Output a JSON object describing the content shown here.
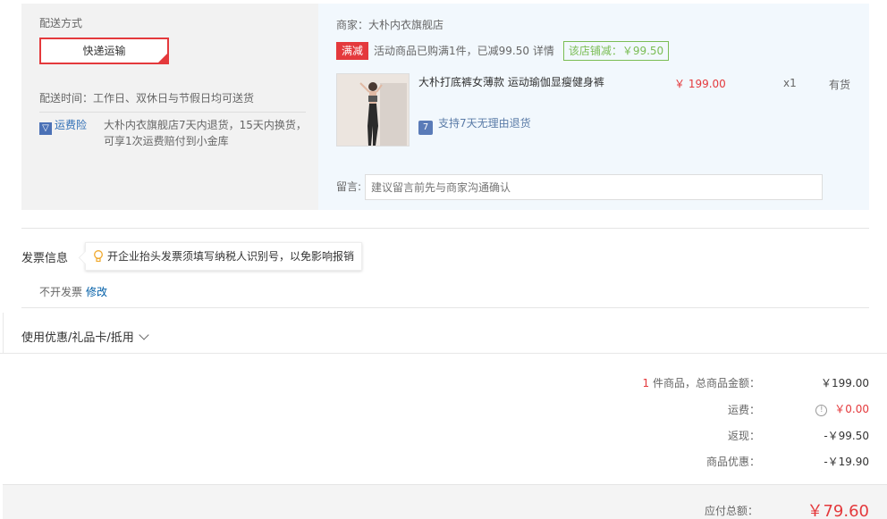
{
  "shipping": {
    "label": "配送方式",
    "method": "快递运输",
    "time_label": "配送时间：",
    "time_value": "工作日、双休日与节假日均可送货",
    "insurance_label": "运费险",
    "insurance_icon": "v-shield-icon",
    "insurance_text": "大朴内衣旗舰店7天内退货，15天内换货，可享1次运费赔付到小金库"
  },
  "shop": {
    "name": "商家：大朴内衣旗舰店",
    "promo_tag": "满减",
    "promo_text": "活动商品已购满1件，已减99.50 详情",
    "store_discount": "该店铺减：￥99.50"
  },
  "item": {
    "title": "大朴打底裤女薄款 运动瑜伽显瘦健身裤",
    "price": "￥ 199.00",
    "qty": "x1",
    "stock": "有货",
    "return_text": "支持7天无理由退货",
    "return_icon": "7-day-return-icon"
  },
  "message": {
    "label": "留言:",
    "placeholder": "建议留言前先与商家沟通确认"
  },
  "invoice": {
    "title": "发票信息",
    "tip": "开企业抬头发票须填写纳税人识别号，以免影响报销",
    "value": "不开发票",
    "edit": "修改"
  },
  "coupon": {
    "label": "使用优惠/礼品卡/抵用"
  },
  "summary": {
    "count": "1",
    "goods_label": "件商品，总商品金额：",
    "goods_value": "￥199.00",
    "freight_label": "运费：",
    "freight_value": "￥0.00",
    "cashback_label": "返现：",
    "cashback_value": "-￥99.50",
    "discount_label": "商品优惠：",
    "discount_value": "-￥19.90",
    "total_label": "应付总额：",
    "total_value": "￥79.60"
  },
  "colors": {
    "accent": "#e4393c",
    "promo_green": "#7abd54",
    "link_blue": "#005ea7"
  }
}
